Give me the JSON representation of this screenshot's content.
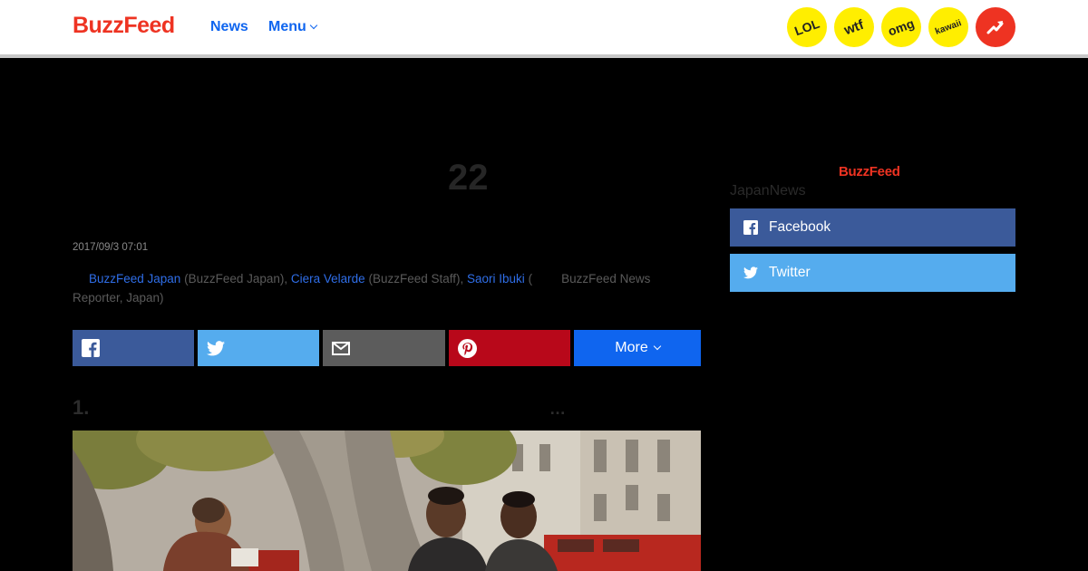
{
  "header": {
    "logo": "BuzzFeed",
    "nav": {
      "news": "News",
      "menu": "Menu"
    },
    "badges": {
      "lol": "LOL",
      "wtf": "wtf",
      "omg": "omg",
      "kawaii": "kawaii"
    },
    "trending_icon": "trending-arrow-icon"
  },
  "article": {
    "headline_number": "22",
    "date": "2017/09/3 07:01",
    "byline": {
      "author1": "BuzzFeed Japan",
      "author1_role": " (BuzzFeed Japan), ",
      "author2": "Ciera Velarde",
      "author2_role": " (BuzzFeed Staff), ",
      "author3": "Saori Ibuki",
      "author3_open": " (",
      "author3_role": "BuzzFeed News Reporter, Japan)"
    },
    "share": {
      "facebook_icon": "facebook-icon",
      "twitter_icon": "twitter-icon",
      "mail_icon": "mail-icon",
      "pinterest_icon": "pinterest-icon",
      "more_label": "More"
    },
    "item_number": "1.",
    "item_ellipsis": "…"
  },
  "sidebar": {
    "logo": "BuzzFeed",
    "label": "JapanNews",
    "facebook_label": "Facebook",
    "twitter_label": "Twitter"
  },
  "colors": {
    "brand_red": "#ee3322",
    "link_blue": "#0f65ef",
    "facebook": "#3b5a9a",
    "twitter": "#55acee",
    "pinterest": "#b8081a",
    "badge_yellow": "#ffee00"
  }
}
